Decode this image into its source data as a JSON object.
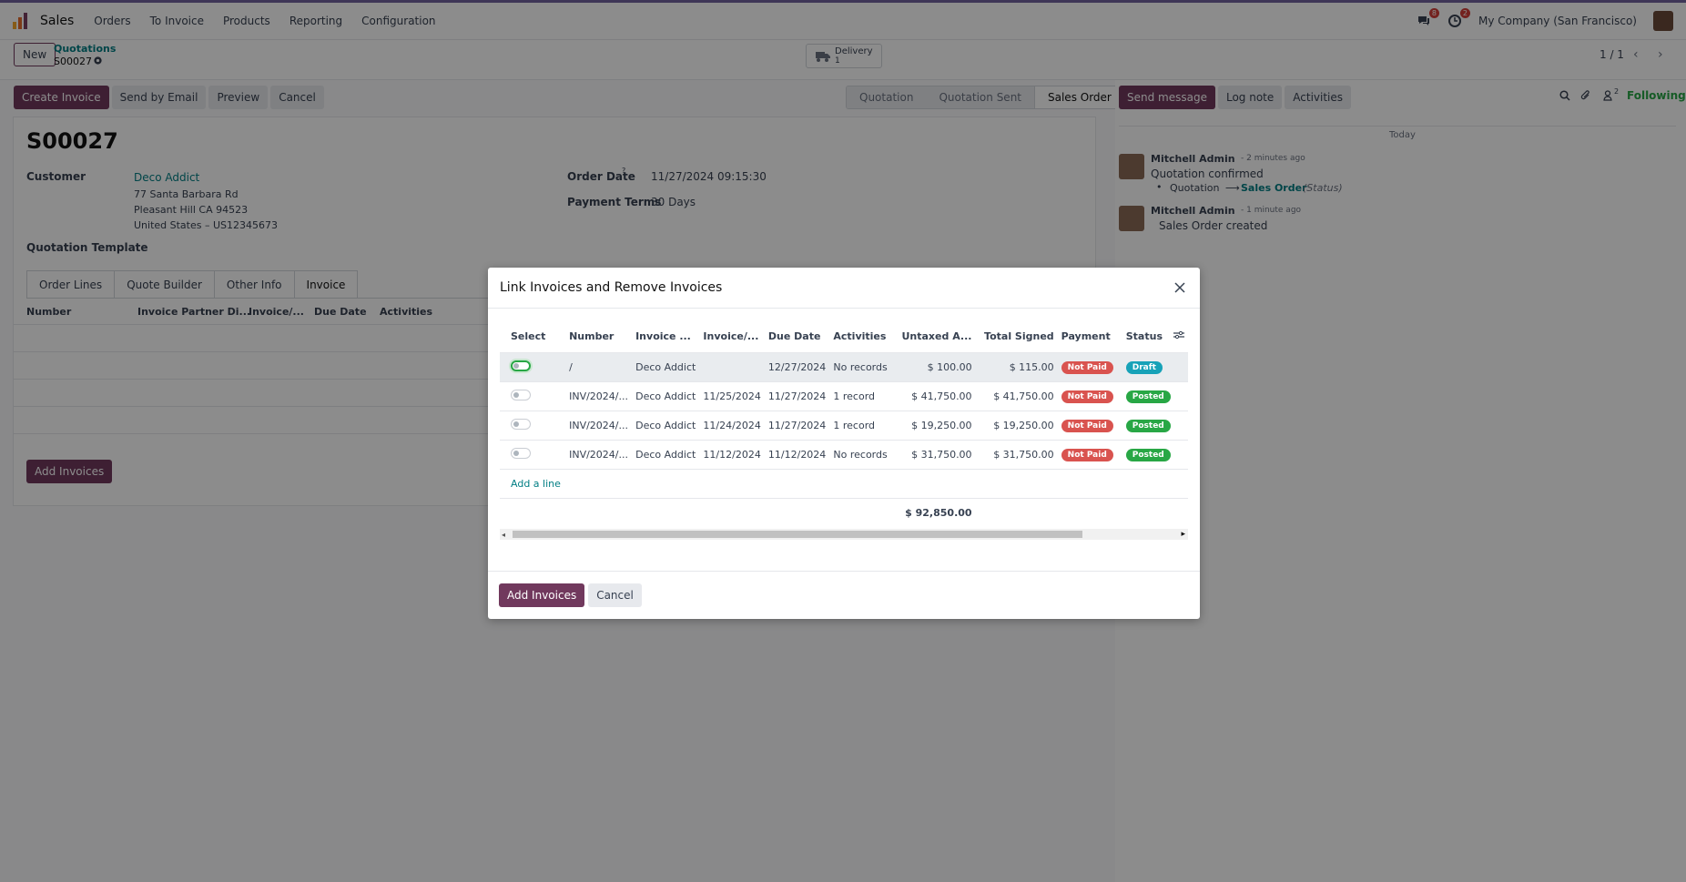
{
  "topbar": {
    "app_name": "Sales",
    "menu": [
      "Orders",
      "To Invoice",
      "Products",
      "Reporting",
      "Configuration"
    ],
    "messages_count": "8",
    "activities_count": "2",
    "company": "My Company (San Francisco)"
  },
  "control_panel": {
    "new_label": "New",
    "breadcrumb_parent": "Quotations",
    "record_name": "S00027",
    "delivery_label": "Delivery",
    "delivery_count": "1",
    "pager": "1 / 1"
  },
  "actions": {
    "create_invoice": "Create Invoice",
    "send_email": "Send by Email",
    "preview": "Preview",
    "cancel": "Cancel"
  },
  "status_steps": [
    "Quotation",
    "Quotation Sent",
    "Sales Order"
  ],
  "form": {
    "title": "S00027",
    "customer_label": "Customer",
    "customer_name": "Deco Addict",
    "address_1": "77 Santa Barbara Rd",
    "address_2": "Pleasant Hill CA 94523",
    "address_3": "United States – US12345673",
    "order_date_label": "Order Date",
    "order_date_help": "?",
    "order_date": "11/27/2024 09:15:30",
    "payment_terms_label": "Payment Terms",
    "payment_terms": "30 Days",
    "template_label": "Quotation Template",
    "tabs": [
      "Order Lines",
      "Quote Builder",
      "Other Info",
      "Invoice"
    ],
    "invoice_columns": [
      "Number",
      "Invoice Partner Di...",
      "Invoice/...",
      "Due Date",
      "Activities"
    ],
    "add_invoices": "Add Invoices"
  },
  "chatter": {
    "send_message": "Send message",
    "log_note": "Log note",
    "activities": "Activities",
    "followers_count": "2",
    "following": "Following",
    "today": "Today",
    "messages": [
      {
        "author": "Mitchell Admin",
        "time": "- 2 minutes ago",
        "body": "Quotation confirmed",
        "tracking_old": "Quotation",
        "tracking_new": "Sales Order",
        "tracking_field": "(Status)"
      },
      {
        "author": "Mitchell Admin",
        "time": "- 1 minute ago",
        "body": "Sales Order created"
      }
    ]
  },
  "modal": {
    "title": "Link Invoices and Remove Invoices",
    "columns": [
      "Select",
      "Number",
      "Invoice ...",
      "Invoice/...",
      "Due Date",
      "Activities",
      "Untaxed A...",
      "Total Signed",
      "Payment",
      "Status"
    ],
    "rows": [
      {
        "selected": true,
        "number": "/",
        "partner": "Deco Addict",
        "invoice_date": "",
        "due_date": "12/27/2024",
        "activities": "No records",
        "untaxed": "$ 100.00",
        "total": "$ 115.00",
        "payment": "Not Paid",
        "status": "Draft"
      },
      {
        "selected": false,
        "number": "INV/2024/...",
        "partner": "Deco Addict",
        "invoice_date": "11/25/2024",
        "due_date": "11/27/2024",
        "activities": "1 record",
        "untaxed": "$ 41,750.00",
        "total": "$ 41,750.00",
        "payment": "Not Paid",
        "status": "Posted"
      },
      {
        "selected": false,
        "number": "INV/2024/...",
        "partner": "Deco Addict",
        "invoice_date": "11/24/2024",
        "due_date": "11/27/2024",
        "activities": "1 record",
        "untaxed": "$ 19,250.00",
        "total": "$ 19,250.00",
        "payment": "Not Paid",
        "status": "Posted"
      },
      {
        "selected": false,
        "number": "INV/2024/...",
        "partner": "Deco Addict",
        "invoice_date": "11/12/2024",
        "due_date": "11/12/2024",
        "activities": "No records",
        "untaxed": "$ 31,750.00",
        "total": "$ 31,750.00",
        "payment": "Not Paid",
        "status": "Posted"
      }
    ],
    "add_line": "Add a line",
    "untaxed_total": "$ 92,850.00",
    "add_invoices": "Add Invoices",
    "cancel": "Cancel"
  },
  "colors": {
    "primary": "#71395d",
    "link": "#017e84",
    "not_paid": "#d9534f",
    "draft": "#17a2b8",
    "posted": "#28a745"
  }
}
